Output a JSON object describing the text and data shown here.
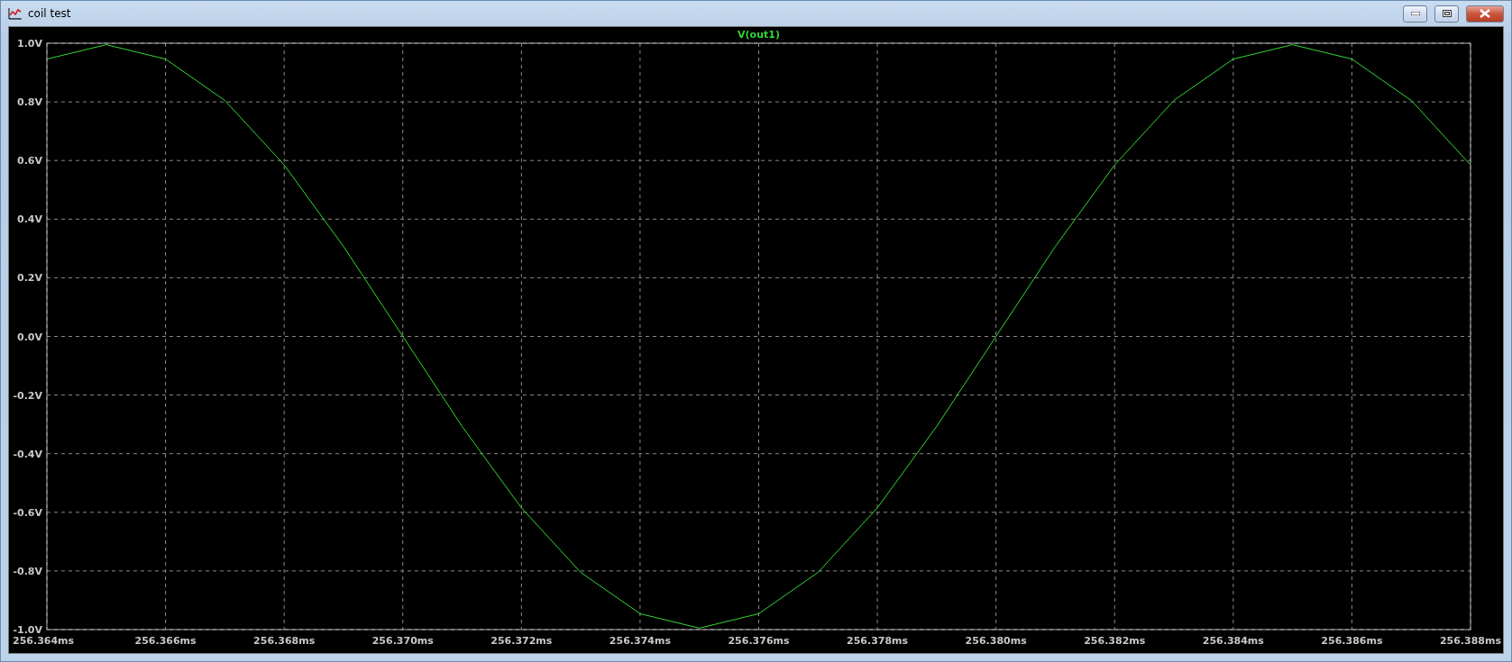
{
  "window": {
    "title": "coil test"
  },
  "plot": {
    "chart_data": {
      "type": "line",
      "x": [
        256.364,
        256.365,
        256.366,
        256.367,
        256.368,
        256.369,
        256.37,
        256.371,
        256.372,
        256.373,
        256.374,
        256.375,
        256.376,
        256.377,
        256.378,
        256.379,
        256.38,
        256.381,
        256.382,
        256.383,
        256.384,
        256.385,
        256.386,
        256.387,
        256.388
      ],
      "series": [
        {
          "name": "V(out1)",
          "color": "#33d633",
          "values": [
            0.946,
            0.995,
            0.946,
            0.805,
            0.585,
            0.307,
            0,
            -0.307,
            -0.585,
            -0.805,
            -0.946,
            -0.995,
            -0.946,
            -0.805,
            -0.585,
            -0.307,
            0,
            0.307,
            0.585,
            0.805,
            0.946,
            0.995,
            0.946,
            0.805,
            0.585
          ]
        }
      ],
      "grid": true,
      "xlim": [
        256.364,
        256.388
      ],
      "ylim": [
        -1,
        1
      ],
      "xticks": [
        {
          "value": 256.364,
          "label": "256.364ms"
        },
        {
          "value": 256.366,
          "label": "256.366ms"
        },
        {
          "value": 256.368,
          "label": "256.368ms"
        },
        {
          "value": 256.37,
          "label": "256.370ms"
        },
        {
          "value": 256.372,
          "label": "256.372ms"
        },
        {
          "value": 256.374,
          "label": "256.374ms"
        },
        {
          "value": 256.376,
          "label": "256.376ms"
        },
        {
          "value": 256.378,
          "label": "256.378ms"
        },
        {
          "value": 256.38,
          "label": "256.380ms"
        },
        {
          "value": 256.382,
          "label": "256.382ms"
        },
        {
          "value": 256.384,
          "label": "256.384ms"
        },
        {
          "value": 256.386,
          "label": "256.386ms"
        },
        {
          "value": 256.388,
          "label": "256.388ms"
        }
      ],
      "yticks": [
        {
          "value": 1,
          "label": "1.0V"
        },
        {
          "value": 0.8,
          "label": "0.8V"
        },
        {
          "value": 0.6,
          "label": "0.6V"
        },
        {
          "value": 0.4,
          "label": "0.4V"
        },
        {
          "value": 0.2,
          "label": "0.2V"
        },
        {
          "value": 0,
          "label": "0.0V"
        },
        {
          "value": -0.2,
          "label": "-0.2V"
        },
        {
          "value": -0.4,
          "label": "-0.4V"
        },
        {
          "value": -0.6,
          "label": "-0.6V"
        },
        {
          "value": -0.8,
          "label": "-0.8V"
        },
        {
          "value": -1,
          "label": "-1.0V"
        }
      ]
    }
  }
}
